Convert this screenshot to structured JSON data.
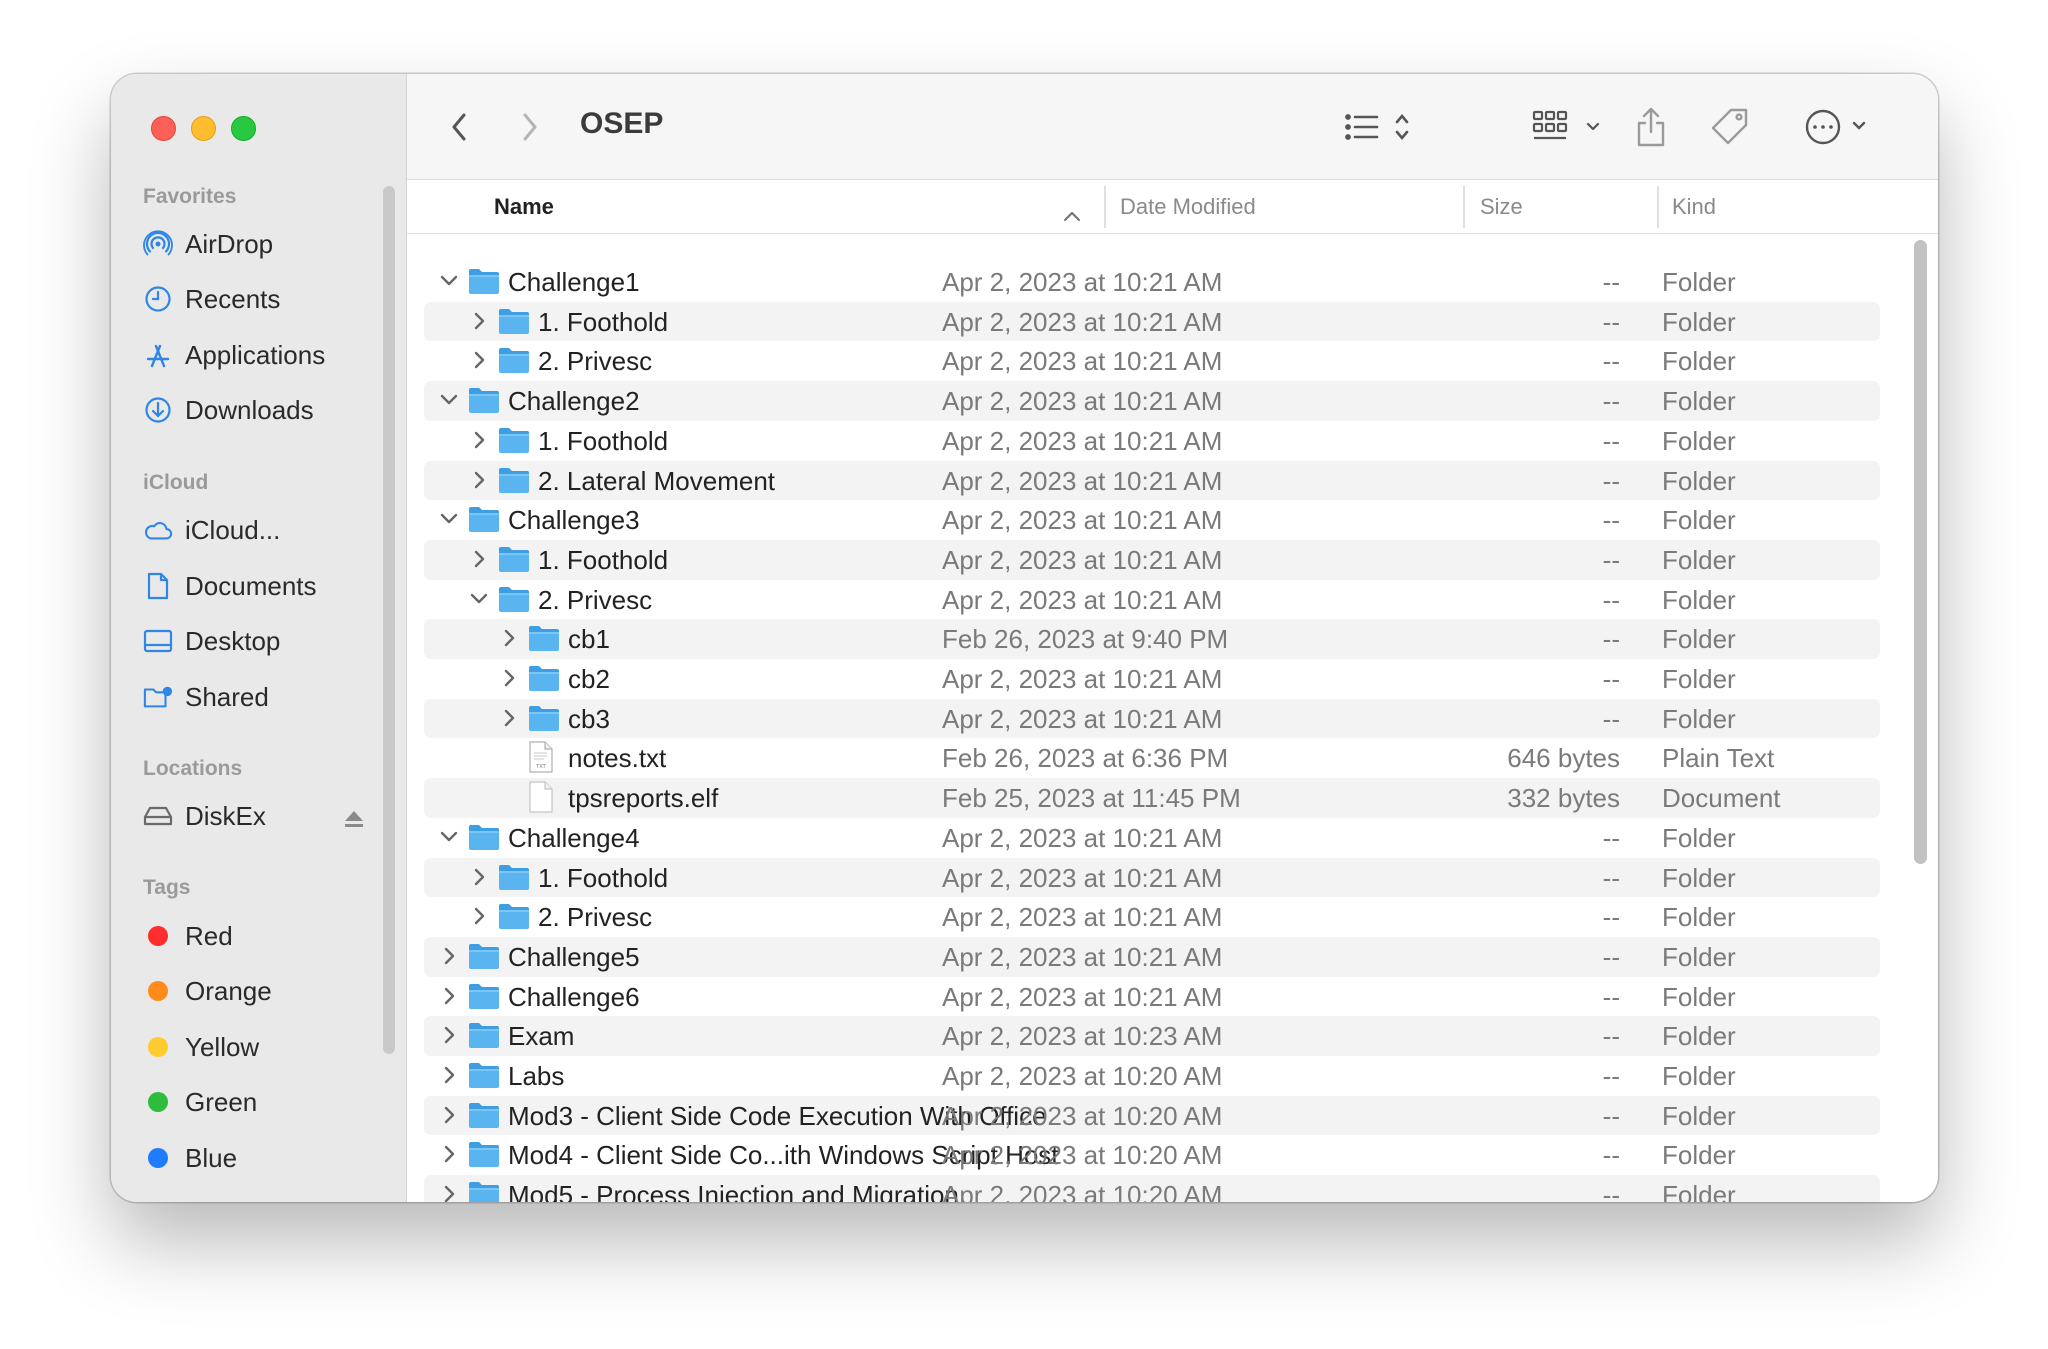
{
  "window": {
    "title": "OSEP"
  },
  "sidebar": {
    "sections": [
      {
        "title": "Favorites",
        "items": [
          {
            "label": "AirDrop",
            "icon": "airdrop-icon"
          },
          {
            "label": "Recents",
            "icon": "clock-icon"
          },
          {
            "label": "Applications",
            "icon": "applications-icon"
          },
          {
            "label": "Downloads",
            "icon": "download-icon"
          }
        ]
      },
      {
        "title": "iCloud",
        "items": [
          {
            "label": "iCloud...",
            "icon": "cloud-icon"
          },
          {
            "label": "Documents",
            "icon": "document-icon"
          },
          {
            "label": "Desktop",
            "icon": "desktop-icon"
          },
          {
            "label": "Shared",
            "icon": "shared-folder-icon"
          }
        ]
      },
      {
        "title": "Locations",
        "items": [
          {
            "label": "DiskEx",
            "icon": "disk-icon"
          }
        ]
      },
      {
        "title": "Tags",
        "items": [
          {
            "label": "Red",
            "color": "#ff2d2d"
          },
          {
            "label": "Orange",
            "color": "#ff8c1a"
          },
          {
            "label": "Yellow",
            "color": "#ffcc2f"
          },
          {
            "label": "Green",
            "color": "#2ebd3b"
          },
          {
            "label": "Blue",
            "color": "#1f7cff"
          }
        ]
      }
    ]
  },
  "columns": {
    "name": "Name",
    "date": "Date Modified",
    "size": "Size",
    "kind": "Kind"
  },
  "rows": [
    {
      "name": "Challenge1",
      "depth": 0,
      "type": "folder",
      "expanded": true,
      "date": "Apr 2, 2023 at 10:21 AM",
      "size": "--",
      "kind": "Folder"
    },
    {
      "name": "1. Foothold",
      "depth": 1,
      "type": "folder",
      "expanded": false,
      "date": "Apr 2, 2023 at 10:21 AM",
      "size": "--",
      "kind": "Folder"
    },
    {
      "name": "2. Privesc",
      "depth": 1,
      "type": "folder",
      "expanded": false,
      "date": "Apr 2, 2023 at 10:21 AM",
      "size": "--",
      "kind": "Folder"
    },
    {
      "name": "Challenge2",
      "depth": 0,
      "type": "folder",
      "expanded": true,
      "date": "Apr 2, 2023 at 10:21 AM",
      "size": "--",
      "kind": "Folder"
    },
    {
      "name": "1. Foothold",
      "depth": 1,
      "type": "folder",
      "expanded": false,
      "date": "Apr 2, 2023 at 10:21 AM",
      "size": "--",
      "kind": "Folder"
    },
    {
      "name": "2. Lateral Movement",
      "depth": 1,
      "type": "folder",
      "expanded": false,
      "date": "Apr 2, 2023 at 10:21 AM",
      "size": "--",
      "kind": "Folder"
    },
    {
      "name": "Challenge3",
      "depth": 0,
      "type": "folder",
      "expanded": true,
      "date": "Apr 2, 2023 at 10:21 AM",
      "size": "--",
      "kind": "Folder"
    },
    {
      "name": "1. Foothold",
      "depth": 1,
      "type": "folder",
      "expanded": false,
      "date": "Apr 2, 2023 at 10:21 AM",
      "size": "--",
      "kind": "Folder"
    },
    {
      "name": "2. Privesc",
      "depth": 1,
      "type": "folder",
      "expanded": true,
      "date": "Apr 2, 2023 at 10:21 AM",
      "size": "--",
      "kind": "Folder"
    },
    {
      "name": "cb1",
      "depth": 2,
      "type": "folder",
      "expanded": false,
      "date": "Feb 26, 2023 at 9:40 PM",
      "size": "--",
      "kind": "Folder"
    },
    {
      "name": "cb2",
      "depth": 2,
      "type": "folder",
      "expanded": false,
      "date": "Apr 2, 2023 at 10:21 AM",
      "size": "--",
      "kind": "Folder"
    },
    {
      "name": "cb3",
      "depth": 2,
      "type": "folder",
      "expanded": false,
      "date": "Apr 2, 2023 at 10:21 AM",
      "size": "--",
      "kind": "Folder"
    },
    {
      "name": "notes.txt",
      "depth": 2,
      "type": "txt",
      "date": "Feb 26, 2023 at 6:36 PM",
      "size": "646 bytes",
      "kind": "Plain Text"
    },
    {
      "name": "tpsreports.elf",
      "depth": 2,
      "type": "doc",
      "date": "Feb 25, 2023 at 11:45 PM",
      "size": "332 bytes",
      "kind": "Document"
    },
    {
      "name": "Challenge4",
      "depth": 0,
      "type": "folder",
      "expanded": true,
      "date": "Apr 2, 2023 at 10:21 AM",
      "size": "--",
      "kind": "Folder"
    },
    {
      "name": "1. Foothold",
      "depth": 1,
      "type": "folder",
      "expanded": false,
      "date": "Apr 2, 2023 at 10:21 AM",
      "size": "--",
      "kind": "Folder"
    },
    {
      "name": "2. Privesc",
      "depth": 1,
      "type": "folder",
      "expanded": false,
      "date": "Apr 2, 2023 at 10:21 AM",
      "size": "--",
      "kind": "Folder"
    },
    {
      "name": "Challenge5",
      "depth": 0,
      "type": "folder",
      "expanded": false,
      "date": "Apr 2, 2023 at 10:21 AM",
      "size": "--",
      "kind": "Folder"
    },
    {
      "name": "Challenge6",
      "depth": 0,
      "type": "folder",
      "expanded": false,
      "date": "Apr 2, 2023 at 10:21 AM",
      "size": "--",
      "kind": "Folder"
    },
    {
      "name": "Exam",
      "depth": 0,
      "type": "folder",
      "expanded": false,
      "date": "Apr 2, 2023 at 10:23 AM",
      "size": "--",
      "kind": "Folder"
    },
    {
      "name": "Labs",
      "depth": 0,
      "type": "folder",
      "expanded": false,
      "date": "Apr 2, 2023 at 10:20 AM",
      "size": "--",
      "kind": "Folder"
    },
    {
      "name": "Mod3 - Client Side Code Execution With Office",
      "depth": 0,
      "type": "folder",
      "expanded": false,
      "date": "Apr 2, 2023 at 10:20 AM",
      "size": "--",
      "kind": "Folder"
    },
    {
      "name": "Mod4 - Client Side Co...ith Windows Script Host",
      "depth": 0,
      "type": "folder",
      "expanded": false,
      "date": "Apr 2, 2023 at 10:20 AM",
      "size": "--",
      "kind": "Folder"
    },
    {
      "name": "Mod5 - Process Injection and Migration",
      "depth": 0,
      "type": "folder",
      "expanded": false,
      "date": "Apr 2, 2023 at 10:20 AM",
      "size": "--",
      "kind": "Folder"
    }
  ],
  "colors": {
    "accent": "#1f7cff",
    "folder": "#5ab4f0",
    "sidebar_icon": "#2f86e6"
  }
}
